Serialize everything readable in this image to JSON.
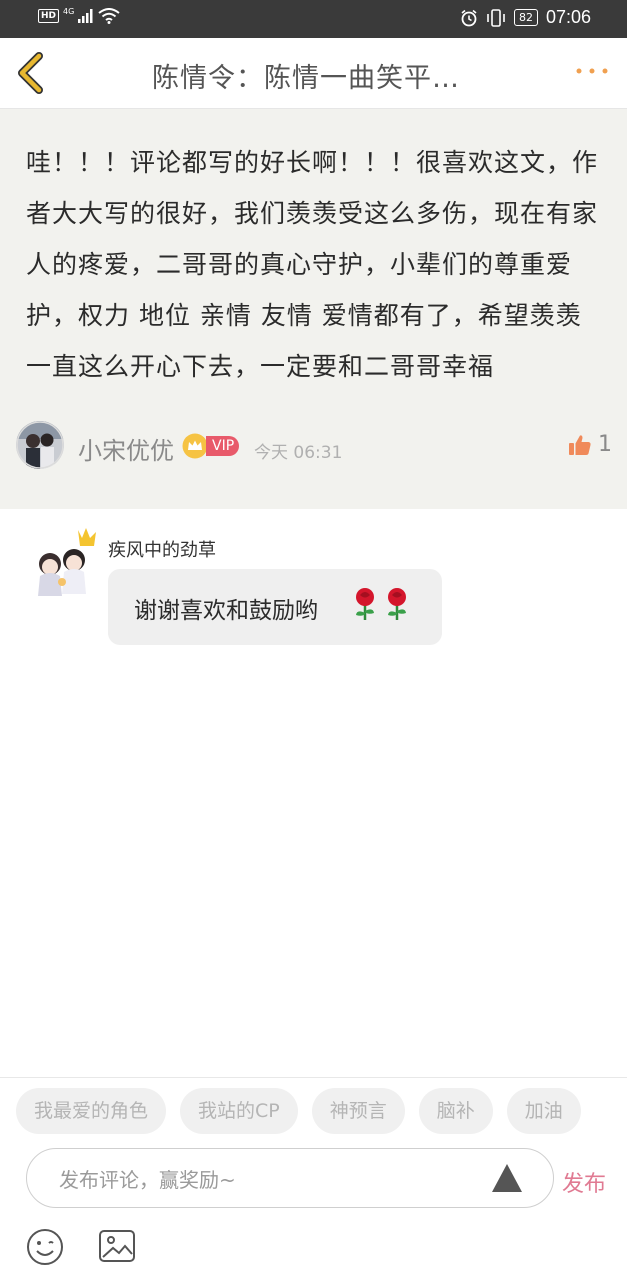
{
  "status_bar": {
    "hd": "HD",
    "network": "4G",
    "battery": "82",
    "time": "07:06",
    "icons": [
      "signal-icon",
      "wifi-icon",
      "alarm-icon",
      "vibrate-icon",
      "battery-icon"
    ]
  },
  "nav": {
    "title": "陈情令：陈情一曲笑平…",
    "icons": [
      "back-arrow-icon",
      "more-dots-icon"
    ]
  },
  "comment": {
    "text": "哇！！！评论都写的好长啊！！！很喜欢这文，作者大大写的很好，我们羡羡受这么多伤，现在有家人的疼爱，二哥哥的真心守护，小辈们的尊重爱护，权力 地位 亲情 友情 爱情都有了，希望羡羡一直这么开心下去，一定要和二哥哥幸福",
    "author": "小宋优优",
    "vip": "VIP",
    "time": "今天 06:31",
    "likes": "1"
  },
  "reply": {
    "author": "疾风中的劲草",
    "text": "谢谢喜欢和鼓励哟",
    "emoji": [
      "rose-icon",
      "rose-icon"
    ]
  },
  "chips": [
    "我最爱的角色",
    "我站的CP",
    "神预言",
    "脑补",
    "加油"
  ],
  "composer": {
    "placeholder": "发布评论，赢奖励~",
    "publish": "发布",
    "icons": [
      "emoji-icon",
      "image-icon",
      "send-arrow-icon"
    ]
  },
  "colors": {
    "status_bar": "#3a3a3a",
    "accent_back": "#e8b830",
    "accent_more": "#f0a050",
    "vip": "#e85a6a",
    "publish": "#e07a92",
    "card_bg": "#f2f2ee"
  }
}
